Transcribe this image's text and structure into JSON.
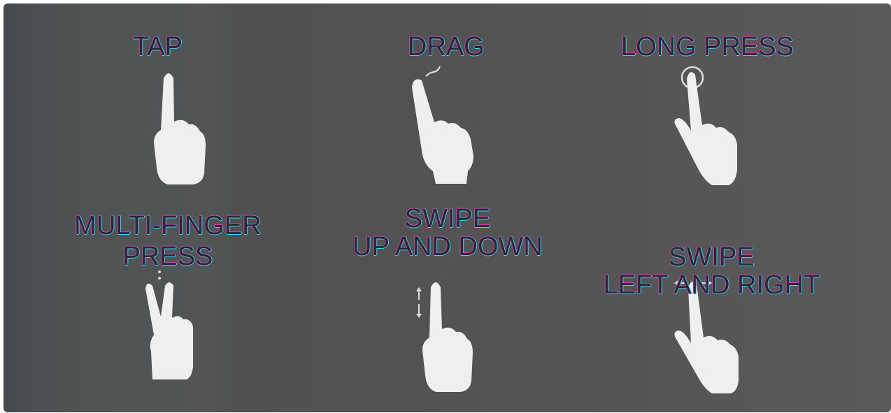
{
  "gestures": {
    "tap": {
      "label": "TAP",
      "icon": "tap-hand-icon"
    },
    "drag": {
      "label": "DRAG",
      "icon": "drag-hand-icon"
    },
    "long_press": {
      "label": "LONG PRESS",
      "icon": "long-press-hand-icon"
    },
    "multi_finger": {
      "label_line1": "MULTI-FINGER",
      "label_line2": "PRESS",
      "icon": "two-finger-hand-icon"
    },
    "swipe_vertical": {
      "label_line1": "SWIPE",
      "label_line2": "UP AND DOWN",
      "icon": "swipe-vertical-hand-icon"
    },
    "swipe_horizontal": {
      "label_line1": "SWIPE",
      "label_line2": "LEFT AND RIGHT",
      "icon": "swipe-horizontal-hand-icon"
    }
  },
  "colors": {
    "background": "#525252",
    "label_text": "#242a2f",
    "label_glow_cyan": "#3fd6ff",
    "label_glow_magenta": "#d73bb7",
    "hand_fill": "#efefef"
  }
}
